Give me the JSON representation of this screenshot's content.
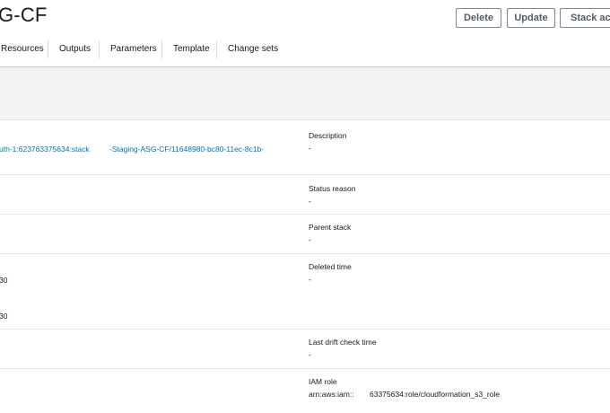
{
  "header": {
    "title": "G-CF",
    "buttons": {
      "delete": "Delete",
      "update": "Update",
      "stack_actions": "Stack actio"
    }
  },
  "tabs": [
    "Resources",
    "Outputs",
    "Parameters",
    "Template",
    "Change sets"
  ],
  "left_col": {
    "stack_id_part1": "uth-1:623763375634:stack",
    "stack_id_part2": "-Staging-ASG-CF/11648980-bc80-11ec-8c1b-",
    "time_a": "30",
    "time_b": "30"
  },
  "right_col": {
    "description": {
      "label": "Description",
      "value": "-"
    },
    "status_reason": {
      "label": "Status reason",
      "value": "-"
    },
    "parent_stack": {
      "label": "Parent stack",
      "value": "-"
    },
    "deleted_time": {
      "label": "Deleted time",
      "value": "-"
    },
    "last_drift": {
      "label": "Last drift check time",
      "value": "-"
    },
    "iam_role": {
      "label": "IAM role",
      "value_part1": "arn:aws:iam::",
      "value_part2": "63375634:role/cloudformation_s3_role"
    }
  },
  "colors": {
    "link": "#0073bb",
    "text": "#16191f",
    "panel": "#f2f3f3"
  }
}
